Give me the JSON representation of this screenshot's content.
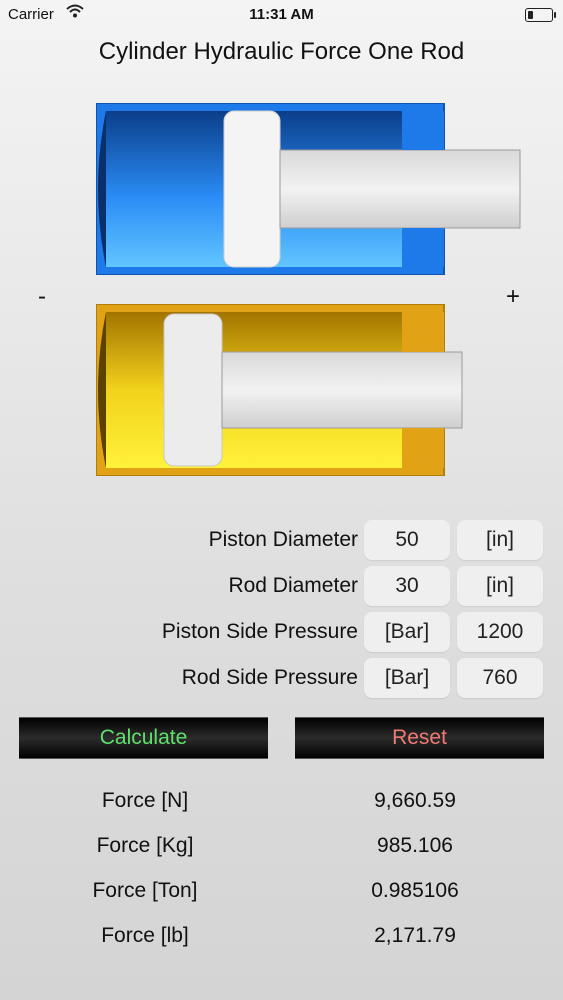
{
  "status_bar": {
    "carrier": "Carrier",
    "time": "11:31 AM"
  },
  "title": "Cylinder Hydraulic Force One Rod",
  "diagram": {
    "minus_label": "-",
    "plus_label": "+",
    "top_cylinder_color": "#1f7ff0",
    "bottom_cylinder_color": "#e3a81c"
  },
  "inputs": [
    {
      "label": "Piston Diameter",
      "a": "50",
      "b": "[in]"
    },
    {
      "label": "Rod Diameter",
      "a": "30",
      "b": "[in]"
    },
    {
      "label": "Piston Side Pressure",
      "a": "[Bar]",
      "b": "1200"
    },
    {
      "label": "Rod Side Pressure",
      "a": "[Bar]",
      "b": "760"
    }
  ],
  "buttons": {
    "calculate": "Calculate",
    "reset": "Reset"
  },
  "results": [
    {
      "label": "Force [N]",
      "value": "9,660.59"
    },
    {
      "label": "Force [Kg]",
      "value": "985.106"
    },
    {
      "label": "Force [Ton]",
      "value": "0.985106"
    },
    {
      "label": "Force [lb]",
      "value": "2,171.79"
    }
  ]
}
